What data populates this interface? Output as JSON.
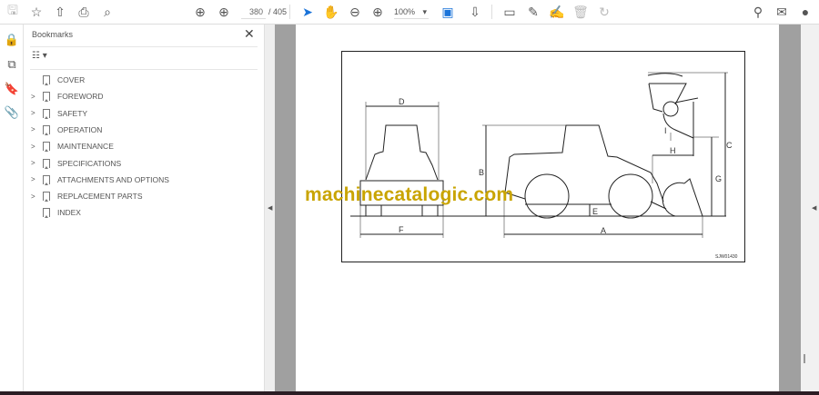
{
  "toolbar": {
    "current_page": "380",
    "total_pages": "/ 405",
    "zoom": "100%"
  },
  "bookmarks": {
    "title": "Bookmarks",
    "items": [
      {
        "label": "COVER",
        "expandable": false
      },
      {
        "label": "FOREWORD",
        "expandable": true
      },
      {
        "label": "SAFETY",
        "expandable": true
      },
      {
        "label": "OPERATION",
        "expandable": true
      },
      {
        "label": "MAINTENANCE",
        "expandable": true
      },
      {
        "label": "SPECIFICATIONS",
        "expandable": true
      },
      {
        "label": "ATTACHMENTS AND OPTIONS",
        "expandable": true
      },
      {
        "label": "REPLACEMENT PARTS",
        "expandable": true
      },
      {
        "label": "INDEX",
        "expandable": false
      }
    ]
  },
  "drawing": {
    "labels": {
      "A": "A",
      "B": "B",
      "C": "C",
      "D": "D",
      "E": "E",
      "F": "F",
      "G": "G",
      "H": "H",
      "I": "I"
    },
    "code": "SJW01430"
  },
  "watermark": "machinecatalogic.com",
  "colors": {
    "accent": "#1a73d9",
    "watermark": "#c9a400"
  }
}
